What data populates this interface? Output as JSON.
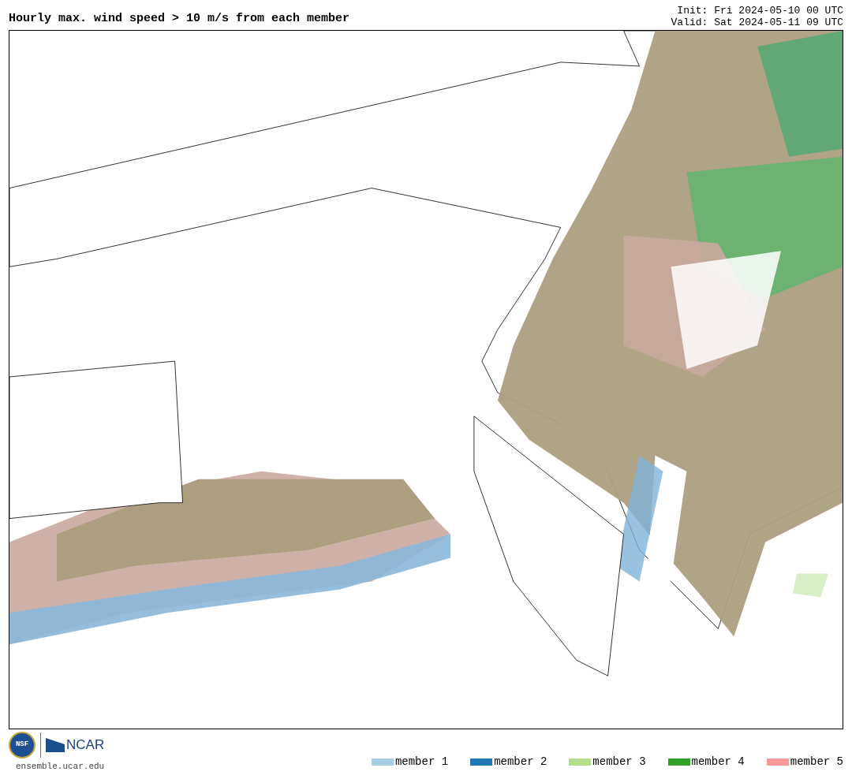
{
  "title": "Hourly max. wind speed > 10 m/s from each member",
  "init": "Init: Fri 2024-05-10 00 UTC",
  "valid": "Valid: Sat 2024-05-11 09 UTC",
  "logos": {
    "nsf": "NSF",
    "ncar": "NCAR",
    "url": "ensemble.ucar.edu"
  },
  "legend": [
    {
      "label": "member 1",
      "color": "#a6cee3"
    },
    {
      "label": "member 2",
      "color": "#1f78b4"
    },
    {
      "label": "member 3",
      "color": "#b2df8a"
    },
    {
      "label": "member 4",
      "color": "#33a02c"
    },
    {
      "label": "member 5",
      "color": "#fb9a99"
    }
  ]
}
